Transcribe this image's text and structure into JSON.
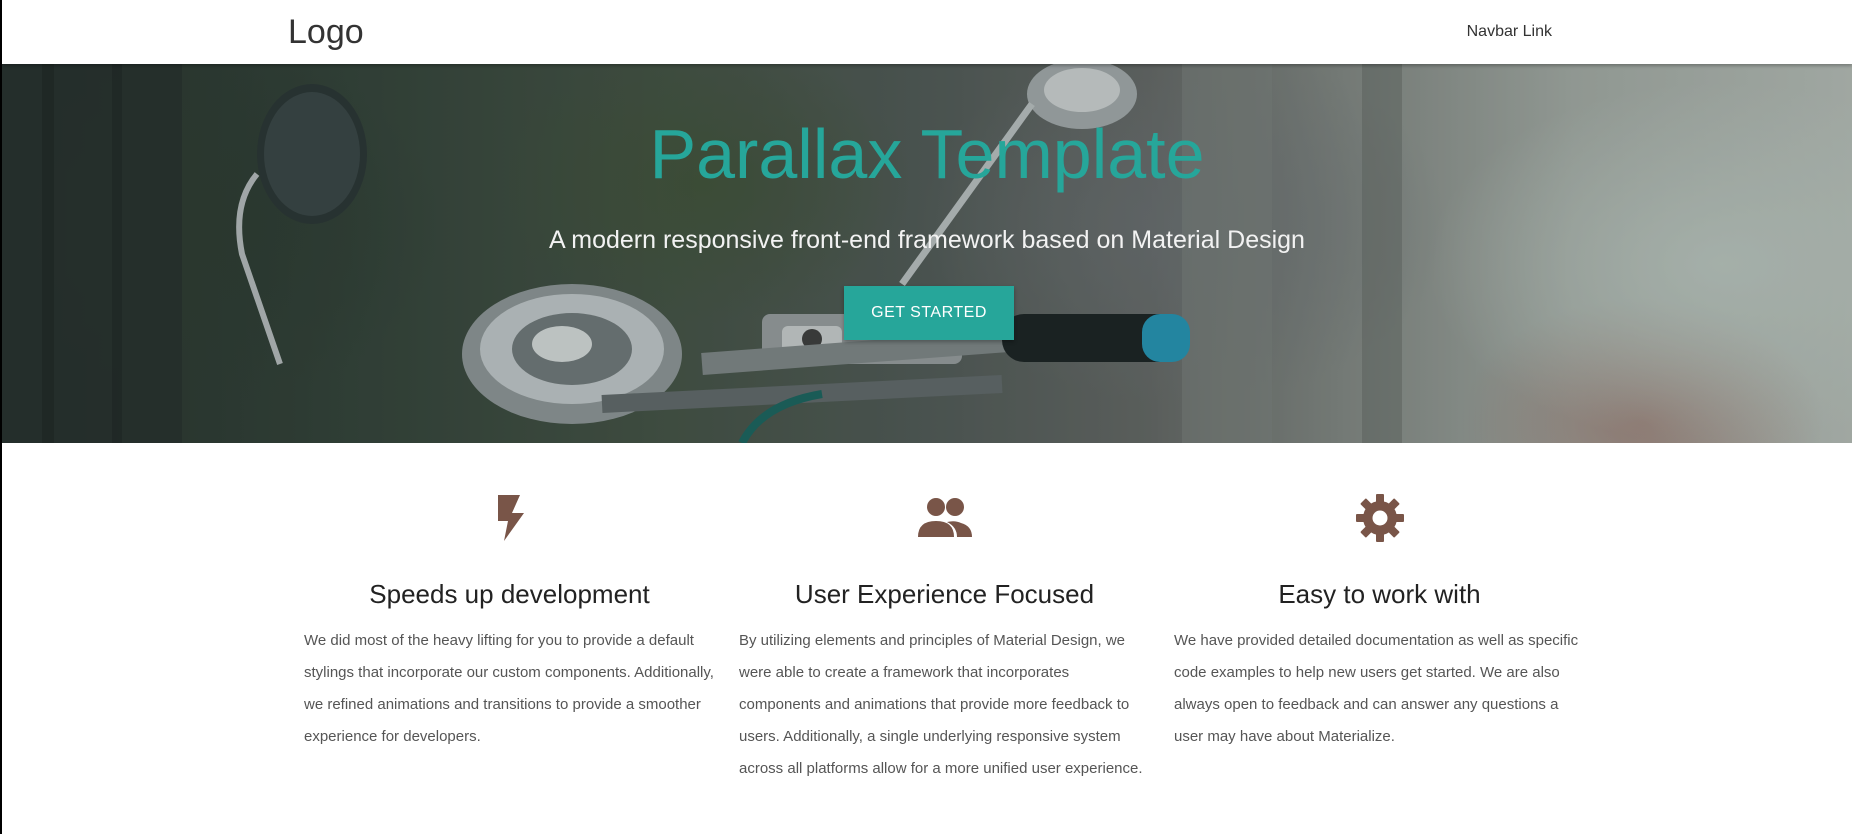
{
  "navbar": {
    "logo": "Logo",
    "link": "Navbar Link"
  },
  "hero": {
    "title": "Parallax Template",
    "subtitle": "A modern responsive front-end framework based on Material Design",
    "button": "GET STARTED"
  },
  "features": [
    {
      "icon": "flash-icon",
      "title": "Speeds up development",
      "text": "We did most of the heavy lifting for you to provide a default stylings that incorporate our custom components. Additionally, we refined animations and transitions to provide a smoother experience for developers."
    },
    {
      "icon": "group-icon",
      "title": "User Experience Focused",
      "text": "By utilizing elements and principles of Material Design, we were able to create a framework that incorporates components and animations that provide more feedback to users. Additionally, a single underlying responsive system across all platforms allow for a more unified user experience."
    },
    {
      "icon": "settings-icon",
      "title": "Easy to work with",
      "text": "We have provided detailed documentation as well as specific code examples to help new users get started. We are also always open to feedback and can answer any questions a user may have about Materialize."
    }
  ],
  "colors": {
    "accent": "#26a69a",
    "icon": "#795548"
  }
}
